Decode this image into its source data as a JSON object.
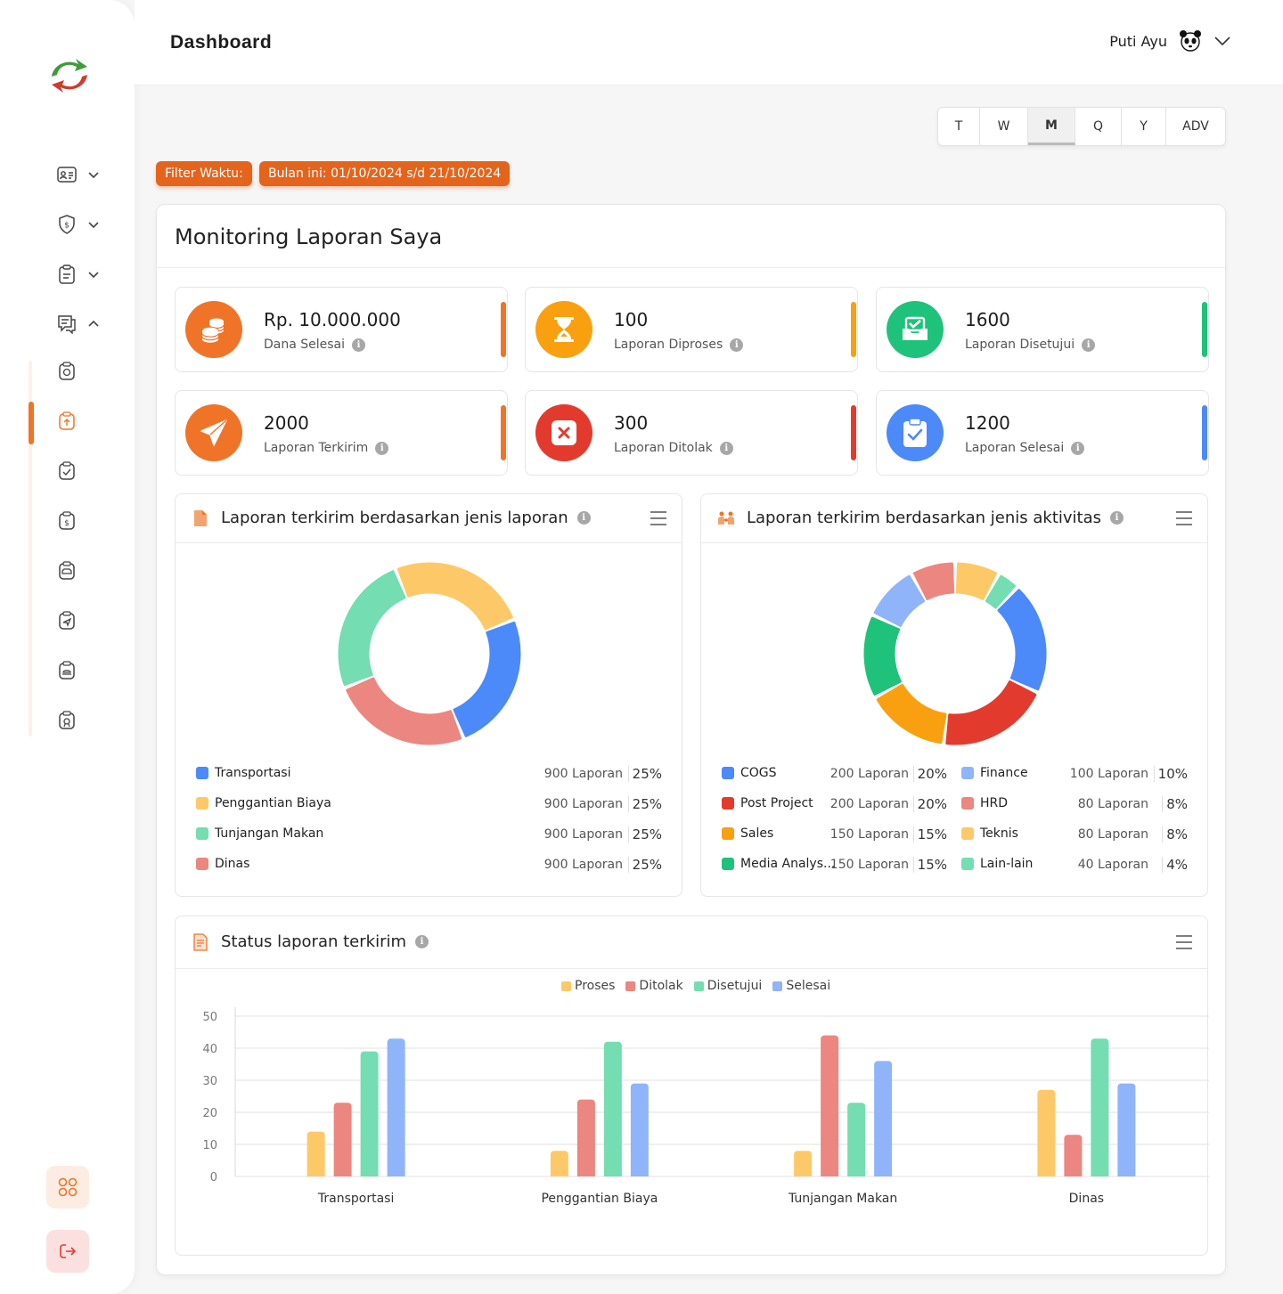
{
  "header": {
    "title": "Dashboard",
    "user_name": "Puti Ayu"
  },
  "period_tabs": [
    {
      "label": "T",
      "active": false
    },
    {
      "label": "W",
      "active": false
    },
    {
      "label": "M",
      "active": true
    },
    {
      "label": "Q",
      "active": false
    },
    {
      "label": "Y",
      "active": false
    },
    {
      "label": "ADV",
      "active": false
    }
  ],
  "filter": {
    "label": "Filter Waktu:",
    "range": "Bulan ini: 01/10/2024 s/d 21/10/2024"
  },
  "panel": {
    "title": "Monitoring Laporan Saya"
  },
  "stats": [
    {
      "value": "Rp. 10.000.000",
      "label": "Dana Selesai",
      "color": "#ef7428",
      "icon": "coins-icon"
    },
    {
      "value": "100",
      "label": "Laporan Diproses",
      "color": "#f9a011",
      "icon": "hourglass-icon"
    },
    {
      "value": "1600",
      "label": "Laporan Disetujui",
      "color": "#1fc27a",
      "icon": "inbox-check-icon"
    },
    {
      "value": "2000",
      "label": "Laporan Terkirim",
      "color": "#ef7428",
      "icon": "paper-plane-icon"
    },
    {
      "value": "300",
      "label": "Laporan Ditolak",
      "color": "#e23b2e",
      "icon": "close-box-icon"
    },
    {
      "value": "1200",
      "label": "Laporan Selesai",
      "color": "#4b8af8",
      "icon": "clipboard-check-icon"
    }
  ],
  "donut_jenis_laporan": {
    "title": "Laporan terkirim berdasarkan jenis laporan",
    "items": [
      {
        "label": "Transportasi",
        "count": "900 Laporan",
        "pct": "25%",
        "color": "#4b8af8"
      },
      {
        "label": "Penggantian Biaya",
        "count": "900 Laporan",
        "pct": "25%",
        "color": "#fdc968"
      },
      {
        "label": "Tunjangan Makan",
        "count": "900 Laporan",
        "pct": "25%",
        "color": "#74ddb2"
      },
      {
        "label": "Dinas",
        "count": "900 Laporan",
        "pct": "25%",
        "color": "#ec8680"
      }
    ]
  },
  "donut_jenis_aktivitas": {
    "title": "Laporan terkirim berdasarkan jenis aktivitas",
    "items": [
      {
        "label": "COGS",
        "count": "200 Laporan",
        "pct": "20%",
        "color": "#4b8af8"
      },
      {
        "label": "Post Project",
        "count": "200 Laporan",
        "pct": "20%",
        "color": "#e23b2e"
      },
      {
        "label": "Sales",
        "count": "150 Laporan",
        "pct": "15%",
        "color": "#f9a011"
      },
      {
        "label": "Media Analys...",
        "count": "150 Laporan",
        "pct": "15%",
        "color": "#1fc27a"
      },
      {
        "label": "Finance",
        "count": "100 Laporan",
        "pct": "10%",
        "color": "#8fb4fa"
      },
      {
        "label": "HRD",
        "count": "80 Laporan",
        "pct": "8%",
        "color": "#ec8680"
      },
      {
        "label": "Teknis",
        "count": "80 Laporan",
        "pct": "8%",
        "color": "#fdc968"
      },
      {
        "label": "Lain-lain",
        "count": "40 Laporan",
        "pct": "4%",
        "color": "#74ddb2"
      }
    ]
  },
  "status_card": {
    "title": "Status laporan terkirim"
  },
  "chart_data": [
    {
      "type": "pie",
      "title": "Laporan terkirim berdasarkan jenis laporan",
      "labels": [
        "Transportasi",
        "Penggantian Biaya",
        "Tunjangan Makan",
        "Dinas"
      ],
      "values": [
        900,
        900,
        900,
        900
      ],
      "colors": [
        "#4b8af8",
        "#fdc968",
        "#74ddb2",
        "#ec8680"
      ]
    },
    {
      "type": "pie",
      "title": "Laporan terkirim berdasarkan jenis aktivitas",
      "labels": [
        "COGS",
        "Post Project",
        "Sales",
        "Media Analys...",
        "Finance",
        "HRD",
        "Teknis",
        "Lain-lain"
      ],
      "values": [
        200,
        200,
        150,
        150,
        100,
        80,
        80,
        40
      ],
      "colors": [
        "#4b8af8",
        "#e23b2e",
        "#f9a011",
        "#1fc27a",
        "#8fb4fa",
        "#ec8680",
        "#fdc968",
        "#74ddb2"
      ]
    },
    {
      "type": "bar",
      "title": "Status laporan terkirim",
      "categories": [
        "Transportasi",
        "Penggantian Biaya",
        "Tunjangan Makan",
        "Dinas"
      ],
      "series": [
        {
          "name": "Proses",
          "color": "#fdc968",
          "values": [
            14,
            8,
            8,
            27
          ]
        },
        {
          "name": "Ditolak",
          "color": "#ec8680",
          "values": [
            23,
            24,
            44,
            13
          ]
        },
        {
          "name": "Disetujui",
          "color": "#74ddb2",
          "values": [
            39,
            42,
            23,
            43
          ]
        },
        {
          "name": "Selesai",
          "color": "#8fb4fa",
          "values": [
            43,
            29,
            36,
            29
          ]
        }
      ],
      "ylim": [
        0,
        50
      ],
      "yticks": [
        0,
        10,
        20,
        30,
        40,
        50
      ],
      "legend": "top-center",
      "grid": true
    }
  ]
}
